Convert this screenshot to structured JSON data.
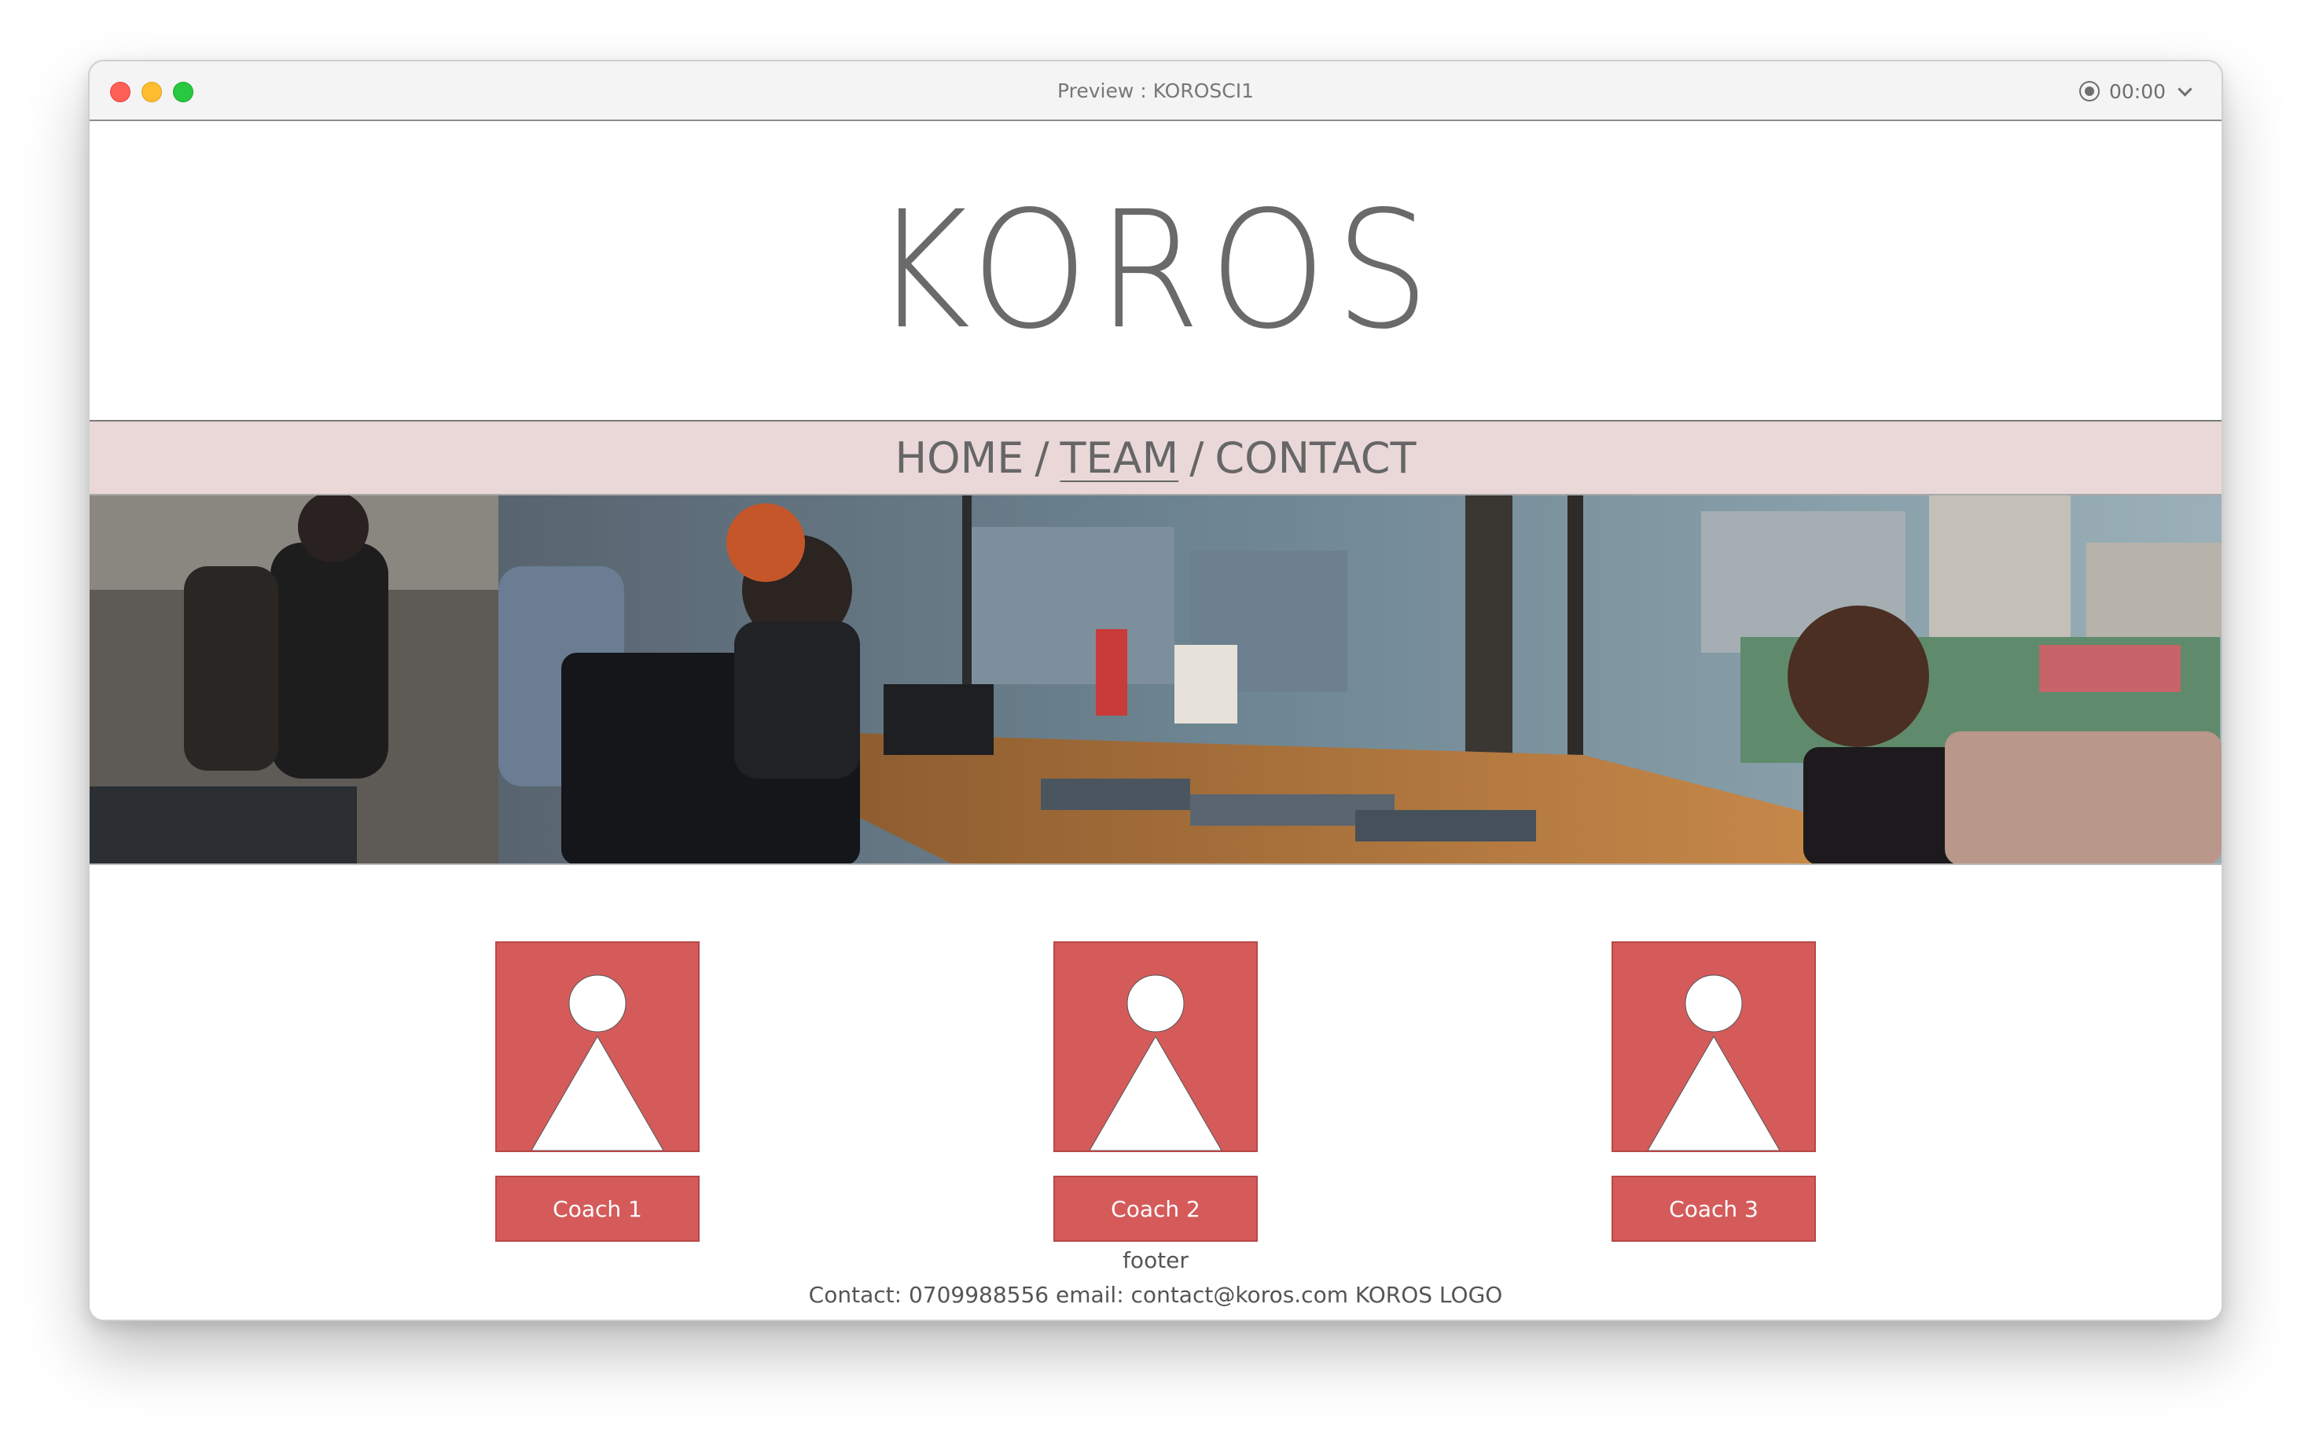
{
  "window": {
    "title": "Preview : KOROSCI1",
    "timer": "00:00"
  },
  "site": {
    "logo": "KOROS",
    "nav": [
      {
        "label": "HOME",
        "active": false
      },
      {
        "label": "TEAM",
        "active": true
      },
      {
        "label": "CONTACT",
        "active": false
      }
    ],
    "nav_separator": "/",
    "coaches": [
      {
        "label": "Coach 1"
      },
      {
        "label": "Coach 2"
      },
      {
        "label": "Coach 3"
      }
    ],
    "footer": {
      "label": "footer",
      "contact": "Contact: 0709988556 email: contact@koros.com KOROS LOGO"
    }
  },
  "colors": {
    "accent": "#d55b5b",
    "nav_bg": "#ead8d8",
    "text": "#666666"
  },
  "icons": {
    "avatar": "person-placeholder-icon",
    "record": "record-icon",
    "dropdown": "chevron-down-icon"
  }
}
